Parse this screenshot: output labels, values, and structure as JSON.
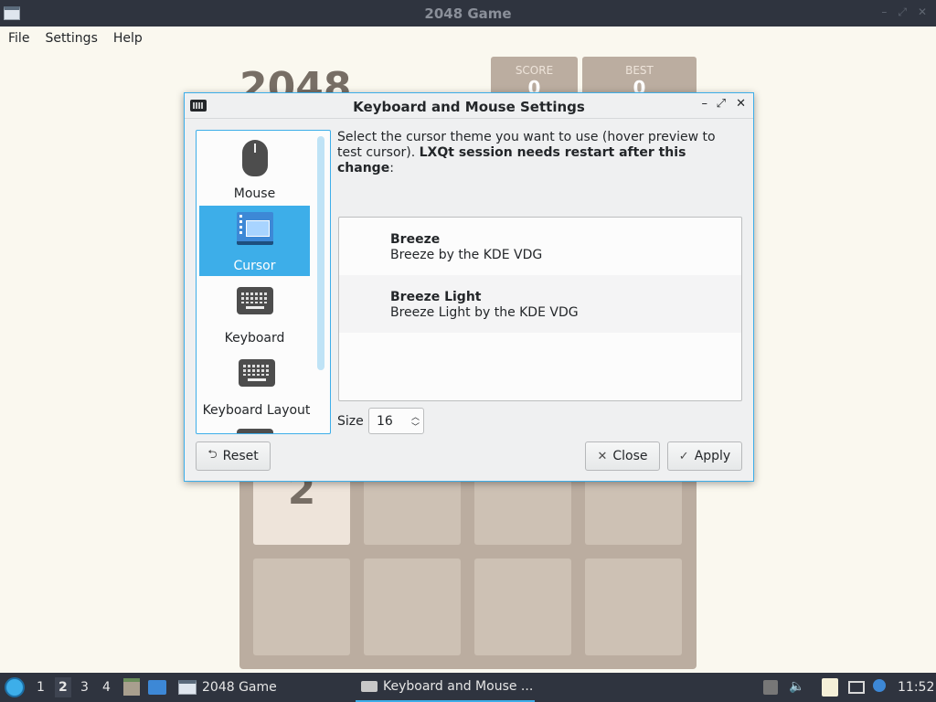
{
  "window": {
    "title": "2048 Game"
  },
  "menubar": {
    "items": [
      "File",
      "Settings",
      "Help"
    ]
  },
  "game": {
    "logo": "2048",
    "score": {
      "label": "SCORE",
      "value": "0"
    },
    "best": {
      "label": "BEST",
      "value": "0"
    },
    "visible_tile": "2"
  },
  "dialog": {
    "title": "Keyboard and Mouse Settings",
    "sidebar": {
      "items": [
        {
          "label": "Mouse",
          "icon": "mouse-icon",
          "selected": false
        },
        {
          "label": "Cursor",
          "icon": "cursor-icon",
          "selected": true
        },
        {
          "label": "Keyboard",
          "icon": "keyboard-icon",
          "selected": false
        },
        {
          "label": "Keyboard Layout",
          "icon": "keyboard-layout-icon",
          "selected": false
        }
      ]
    },
    "description_plain": "Select the cursor theme you want to use (hover preview to test cursor). ",
    "description_bold": "LXQt session needs restart after this change",
    "description_tail": ":",
    "themes": [
      {
        "name": "Breeze",
        "description": "Breeze by the KDE VDG"
      },
      {
        "name": "Breeze Light",
        "description": "Breeze Light by the KDE VDG"
      }
    ],
    "size": {
      "label": "Size",
      "value": "16"
    },
    "buttons": {
      "reset": "Reset",
      "close": "Close",
      "apply": "Apply"
    }
  },
  "taskbar": {
    "workspaces": [
      "1",
      "2",
      "3",
      "4"
    ],
    "active_workspace": "2",
    "tasks": [
      {
        "label": "2048 Game",
        "icon": "window-icon",
        "active": false
      },
      {
        "label": "Keyboard and Mouse ...",
        "icon": "keyboard-icon",
        "active": true
      }
    ],
    "clock": "11:52"
  },
  "colors": {
    "accent": "#3daee9",
    "panel": "#2f343f",
    "game_bg": "#faf8ef"
  }
}
